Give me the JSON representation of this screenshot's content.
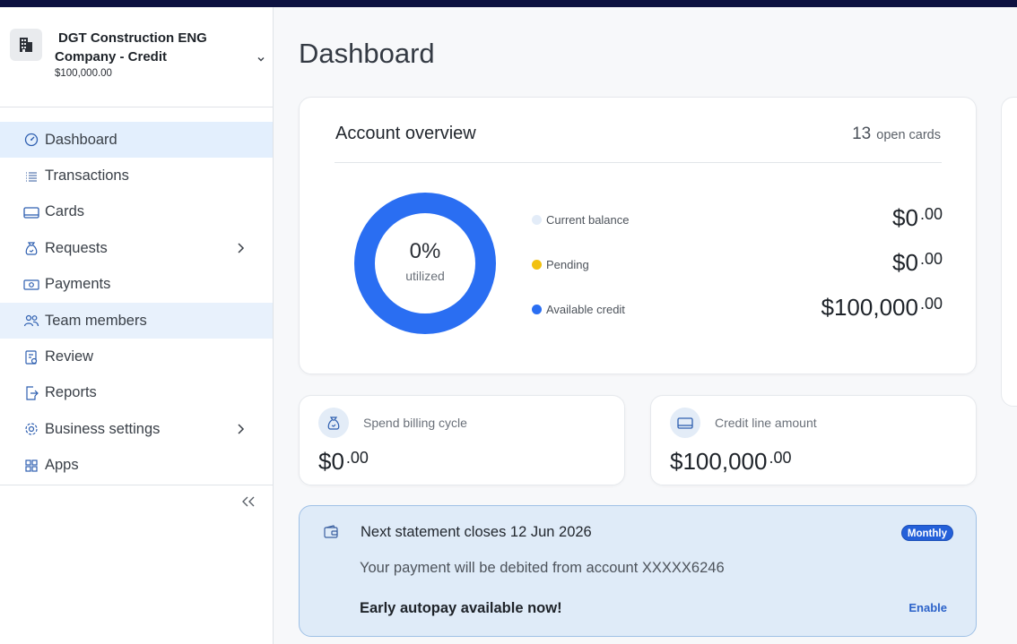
{
  "org": {
    "name_line1": "DGT Construction ENG",
    "name_line2": "Company - Credit",
    "amount": "$100,000.00"
  },
  "nav": {
    "items": [
      {
        "label": "Dashboard",
        "icon": "gauge-icon"
      },
      {
        "label": "Transactions",
        "icon": "list-icon"
      },
      {
        "label": "Cards",
        "icon": "card-icon"
      },
      {
        "label": "Requests",
        "icon": "money-bag-icon"
      },
      {
        "label": "Payments",
        "icon": "banknote-icon"
      },
      {
        "label": "Team members",
        "icon": "people-icon"
      },
      {
        "label": "Review",
        "icon": "clipboard-icon"
      },
      {
        "label": "Reports",
        "icon": "export-icon"
      },
      {
        "label": "Business settings",
        "icon": "gear-icon"
      },
      {
        "label": "Apps",
        "icon": "grid-icon"
      }
    ]
  },
  "page": {
    "title": "Dashboard"
  },
  "overview": {
    "title": "Account overview",
    "open_count": "13",
    "open_label": "open cards",
    "utilized_pct": "0%",
    "utilized_label": "utilized",
    "utilized_fraction": 0,
    "legend": [
      {
        "label": "Current balance",
        "dollars": "$0",
        "cents": ".00",
        "color": "#e3ecf8"
      },
      {
        "label": "Pending",
        "dollars": "$0",
        "cents": ".00",
        "color": "#f2c10f"
      },
      {
        "label": "Available credit",
        "dollars": "$100,000",
        "cents": ".00",
        "color": "#2a6ef2"
      }
    ]
  },
  "spend": {
    "label": "Spend billing cycle",
    "dollars": "$0",
    "cents": ".00"
  },
  "credit_line": {
    "label": "Credit line amount",
    "dollars": "$100,000",
    "cents": ".00"
  },
  "statement": {
    "title": "Next statement closes 12 Jun 2026",
    "badge": "Monthly",
    "text": "Your payment will be debited from account XXXXX6246",
    "autopay": "Early autopay available now!",
    "enable": "Enable"
  }
}
